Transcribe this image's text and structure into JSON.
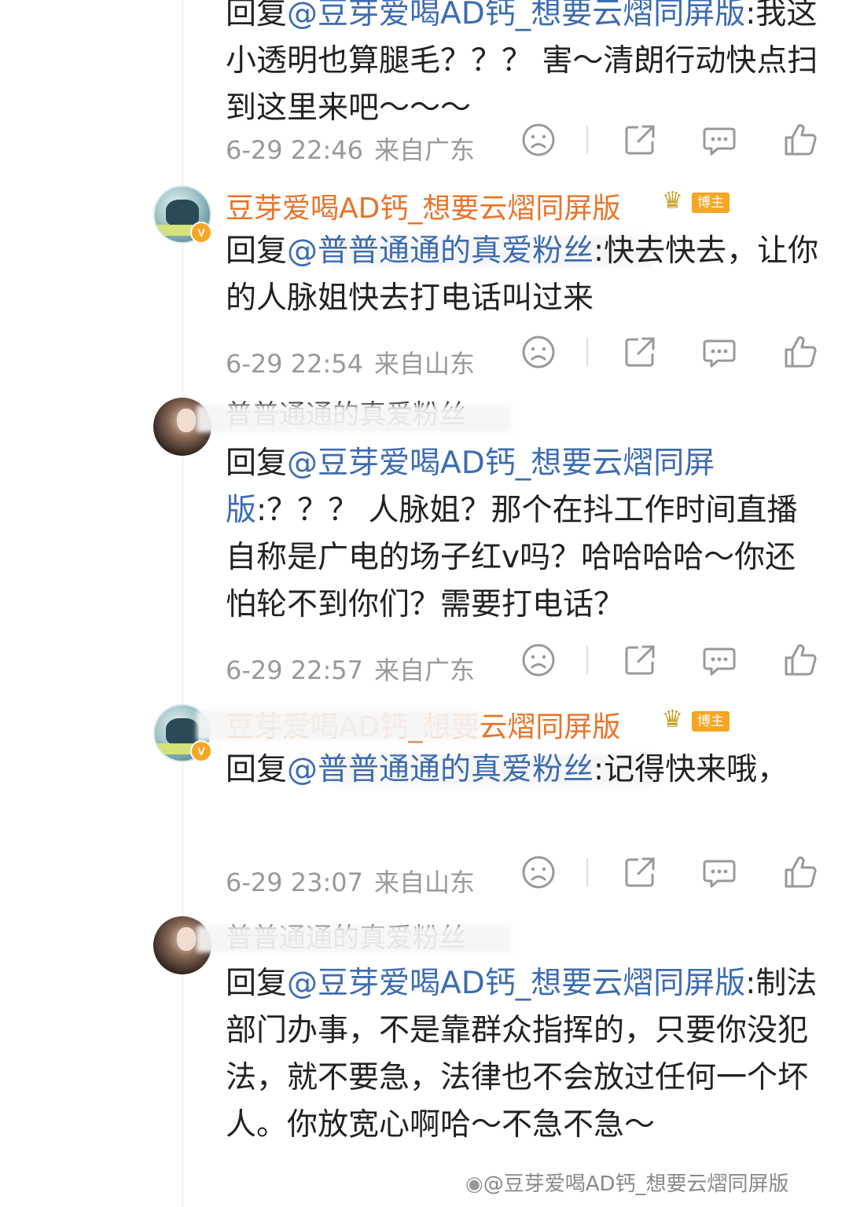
{
  "comments": [
    {
      "user": "",
      "reply_prefix": "回复",
      "mention": "@豆芽爱喝AD钙_想要云熠同屏",
      "mention_tail": "版",
      "text": ":我这小透明也算腿毛？？？ 害～清朗行动快点扫到这里来吧～～～",
      "time": "6-29 22:46",
      "location": "来自广东"
    },
    {
      "user": "豆芽爱喝AD钙_想要云熠同屏版",
      "badge": "博主",
      "reply_prefix": "回复",
      "mention": "@普普通通的真爱粉丝",
      "text": ":快去快去，让你的人脉姐快去打电话叫过来",
      "time": "6-29 22:54",
      "location": "来自山东"
    },
    {
      "user": "普普通通的真爱粉丝",
      "reply_prefix": "回复",
      "mention": "@豆芽爱喝AD钙_想要云熠同屏",
      "mention_tail": "版",
      "text": ":？？？ 人脉姐？那个在抖工作时间直播自称是广电的场子红v吗？哈哈哈哈～你还怕轮不到你们？需要打电话？",
      "time": "6-29 22:57",
      "location": "来自广东"
    },
    {
      "user": "豆芽爱喝AD钙_想要云熠同屏版",
      "badge": "博主",
      "reply_prefix": "回复",
      "mention": "@普普通通的真爱粉丝",
      "text": ":记得快来哦，",
      "time": "6-29 23:07",
      "location": "来自山东"
    },
    {
      "user": "普普通通的真爱粉丝",
      "reply_prefix": "回复",
      "mention": "@豆芽爱喝AD钙_想要云熠同屏",
      "mention_tail": "版",
      "text": ":制法部门办事，不是靠群众指挥的，只要你没犯法，就不要急，法律也不会放过任何一个坏人。你放宽心啊哈～不急不急～"
    }
  ],
  "icons": {
    "dislike": "sad-face-icon",
    "share": "share-icon",
    "comment": "comment-icon",
    "like": "thumbs-up-icon"
  },
  "watermark": "@豆芽爱喝AD钙_想要云熠同屏版",
  "colors": {
    "mention": "#3d6cb0",
    "blogger_name": "#e8732a",
    "meta": "#999999",
    "badge": "#f5a623"
  }
}
